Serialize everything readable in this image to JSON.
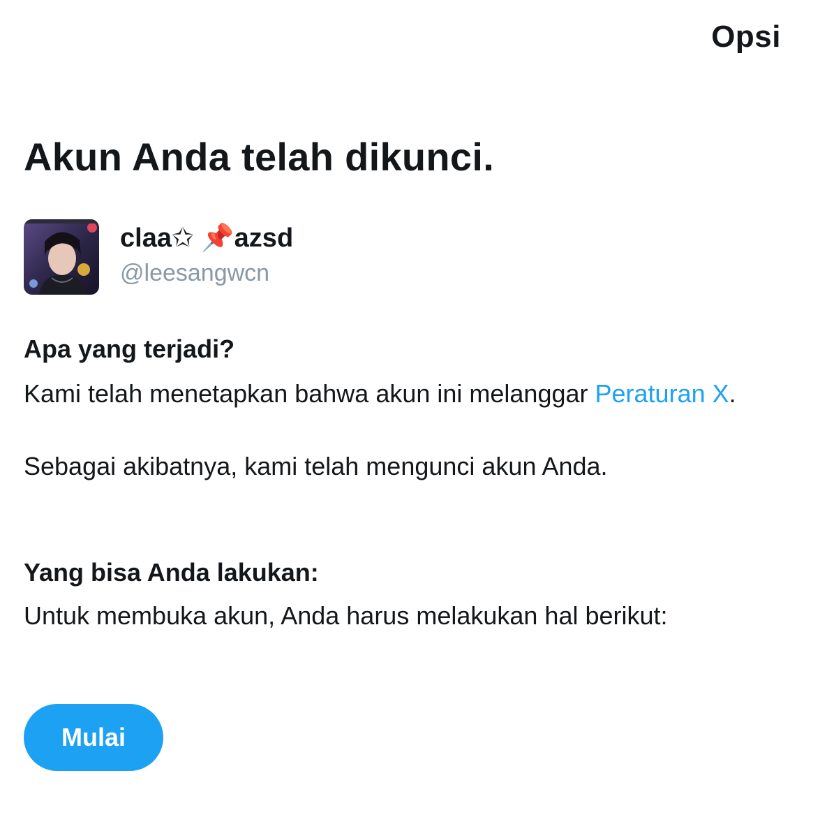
{
  "header": {
    "options_label": "Opsi"
  },
  "page": {
    "title": "Akun Anda telah dikunci."
  },
  "profile": {
    "display_name": "claa✩ 📌azsd",
    "handle": "@leesangwcn"
  },
  "what_happened": {
    "heading": "Apa yang terjadi?",
    "text_before_link": "Kami telah menetapkan bahwa akun ini melanggar ",
    "link_label": "Peraturan X",
    "text_after_link": ".",
    "consequence": "Sebagai akibatnya, kami telah mengunci akun Anda."
  },
  "what_you_can_do": {
    "heading": "Yang bisa Anda lakukan:",
    "text": "Untuk membuka akun, Anda harus melakukan hal berikut:"
  },
  "actions": {
    "start_label": "Mulai"
  },
  "colors": {
    "accent": "#1da1f2",
    "text_primary": "#14171a",
    "text_secondary": "#8899a6",
    "background": "#ffffff"
  }
}
